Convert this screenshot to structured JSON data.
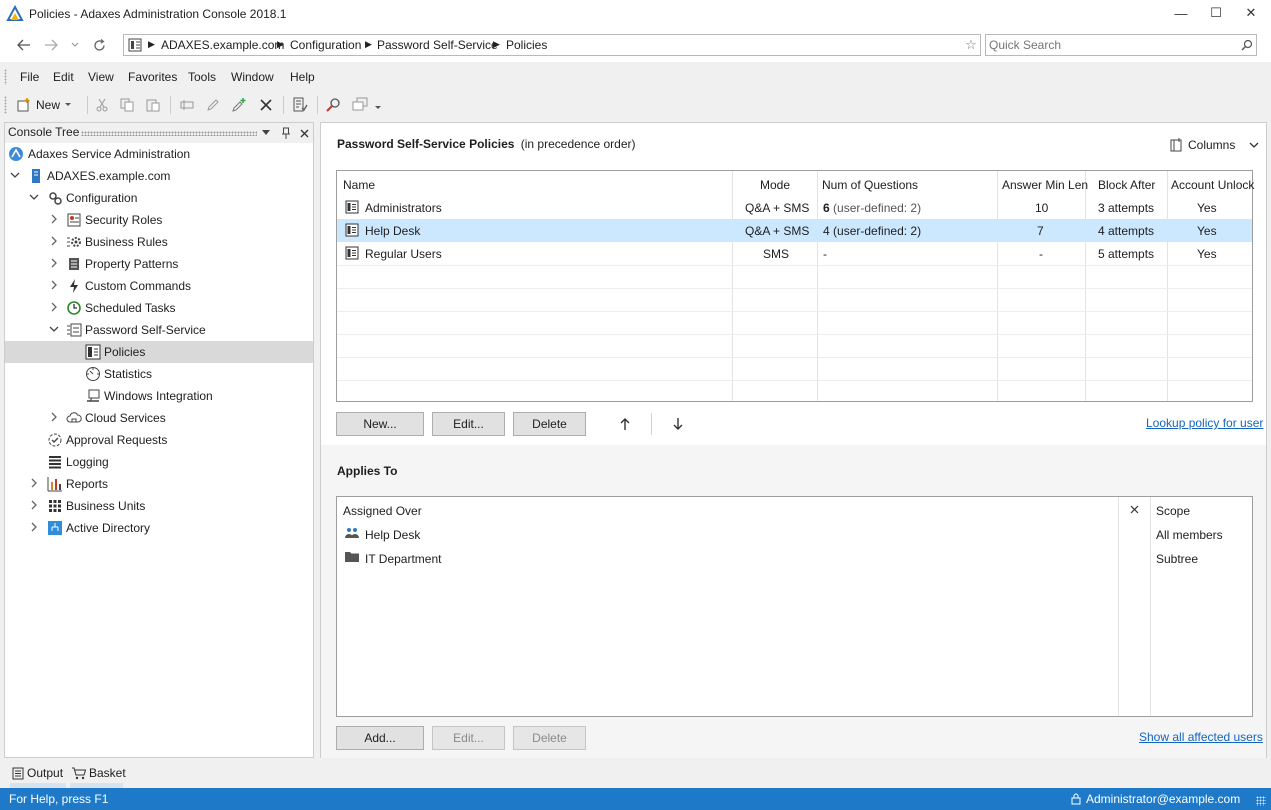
{
  "window": {
    "title": "Policies - Adaxes Administration Console 2018.1",
    "minimize_glyph": "—",
    "maximize_glyph": "☐",
    "close_glyph": "✕"
  },
  "address": {
    "crumbs": [
      "ADAXES.example.com",
      "Configuration",
      "Password Self-Service",
      "Policies"
    ],
    "search_placeholder": "Quick Search"
  },
  "menu": [
    "File",
    "Edit",
    "View",
    "Favorites",
    "Tools",
    "Window",
    "Help"
  ],
  "toolbar": {
    "new_label": "New"
  },
  "console_tree": {
    "header": "Console Tree",
    "items": [
      {
        "label": "Adaxes Service Administration",
        "icon": "adaxes-logo-icon"
      },
      {
        "label": "ADAXES.example.com",
        "icon": "domain-icon"
      },
      {
        "label": "Configuration",
        "icon": "configuration-icon"
      },
      {
        "label": "Security Roles",
        "icon": "security-roles-icon"
      },
      {
        "label": "Business Rules",
        "icon": "business-rules-icon"
      },
      {
        "label": "Property Patterns",
        "icon": "property-patterns-icon"
      },
      {
        "label": "Custom Commands",
        "icon": "custom-commands-icon"
      },
      {
        "label": "Scheduled Tasks",
        "icon": "scheduled-tasks-icon"
      },
      {
        "label": "Password Self-Service",
        "icon": "password-self-service-icon"
      },
      {
        "label": "Policies",
        "icon": "policy-icon"
      },
      {
        "label": "Statistics",
        "icon": "statistics-icon"
      },
      {
        "label": "Windows Integration",
        "icon": "windows-integration-icon"
      },
      {
        "label": "Cloud Services",
        "icon": "cloud-services-icon"
      },
      {
        "label": "Approval Requests",
        "icon": "approval-requests-icon"
      },
      {
        "label": "Logging",
        "icon": "logging-icon"
      },
      {
        "label": "Reports",
        "icon": "reports-icon"
      },
      {
        "label": "Business Units",
        "icon": "business-units-icon"
      },
      {
        "label": "Active Directory",
        "icon": "active-directory-icon"
      }
    ]
  },
  "policies": {
    "title": "Password Self-Service Policies",
    "subtitle": "(in precedence order)",
    "columns_button": "Columns",
    "headers": [
      "Name",
      "Mode",
      "Num of Questions",
      "Answer Min Len",
      "Block After",
      "Account Unlock"
    ],
    "rows": [
      {
        "name": "Administrators",
        "mode": "Q&A + SMS",
        "num": "6",
        "num_suffix": "(user-defined: 2)",
        "minlen": "10",
        "block": "3 attempts",
        "unlock": "Yes"
      },
      {
        "name": "Help Desk",
        "mode": "Q&A + SMS",
        "num": "4",
        "num_suffix": "(user-defined: 2)",
        "minlen": "7",
        "block": "4 attempts",
        "unlock": "Yes"
      },
      {
        "name": "Regular Users",
        "mode": "SMS",
        "num": "-",
        "num_suffix": "",
        "minlen": "-",
        "block": "5 attempts",
        "unlock": "Yes"
      }
    ],
    "buttons": {
      "new": "New...",
      "edit": "Edit...",
      "delete": "Delete"
    },
    "lookup_link": "Lookup policy for user"
  },
  "applies_to": {
    "title": "Applies To",
    "headers": [
      "Assigned Over",
      "Scope"
    ],
    "rows": [
      {
        "name": "Help Desk",
        "scope": "All members",
        "icon": "group-icon"
      },
      {
        "name": "IT Department",
        "scope": "Subtree",
        "icon": "folder-icon"
      }
    ],
    "buttons": {
      "add": "Add...",
      "edit": "Edit...",
      "delete": "Delete"
    },
    "show_link": "Show all affected users"
  },
  "bottom_tabs": [
    "Output",
    "Basket"
  ],
  "status": {
    "help": "For Help, press F1",
    "user": "Administrator@example.com"
  },
  "colors": {
    "accent": "#1e7ac9",
    "selection": "#cce8ff",
    "tree_selection": "#d9d9d9",
    "link": "#1565c0"
  }
}
